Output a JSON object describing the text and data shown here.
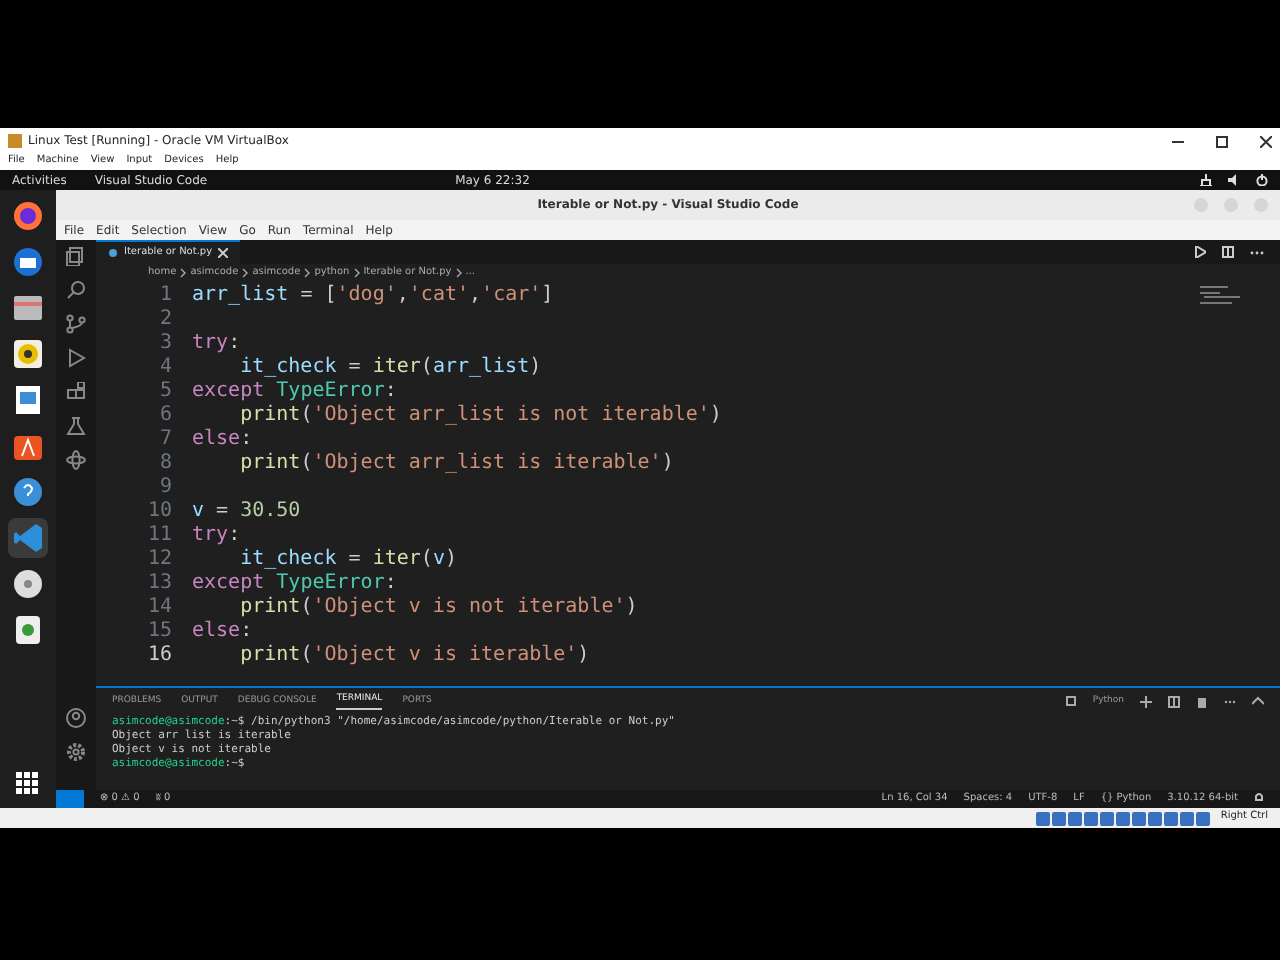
{
  "vbox": {
    "title": "Linux Test [Running] - Oracle VM VirtualBox",
    "menu": [
      "File",
      "Machine",
      "View",
      "Input",
      "Devices",
      "Help"
    ],
    "status_right": "Right Ctrl"
  },
  "topbar": {
    "activities": "Activities",
    "app": "Visual Studio Code",
    "clock": "May 6  22:32"
  },
  "dock": [
    {
      "kind": "firefox",
      "selected": false
    },
    {
      "kind": "thunderbird",
      "selected": false
    },
    {
      "kind": "files",
      "selected": false
    },
    {
      "kind": "rhythmbox",
      "selected": false
    },
    {
      "kind": "writer",
      "selected": false
    },
    {
      "kind": "software",
      "selected": false
    },
    {
      "kind": "help",
      "selected": false
    },
    {
      "kind": "vscode",
      "selected": true
    },
    {
      "kind": "disc",
      "selected": false
    },
    {
      "kind": "trash",
      "selected": false
    }
  ],
  "vscode": {
    "title": "Iterable or Not.py - Visual Studio Code",
    "menu": [
      "File",
      "Edit",
      "Selection",
      "View",
      "Go",
      "Run",
      "Terminal",
      "Help"
    ],
    "tab": "Iterable or Not.py",
    "breadcrumb": [
      "home",
      "asimcode",
      "asimcode",
      "python",
      "Iterable or Not.py",
      "..."
    ],
    "lines": [
      {
        "number": "1",
        "current": false,
        "tokens": [
          {
            "kind": "var",
            "text": "arr_list"
          },
          {
            "kind": "op",
            "text": " = ["
          },
          {
            "kind": "str",
            "text": "'dog'"
          },
          {
            "kind": "op",
            "text": ","
          },
          {
            "kind": "str",
            "text": "'cat'"
          },
          {
            "kind": "op",
            "text": ","
          },
          {
            "kind": "str",
            "text": "'car'"
          },
          {
            "kind": "op",
            "text": "]"
          }
        ]
      },
      {
        "number": "2",
        "current": false
      },
      {
        "number": "3",
        "current": false,
        "tokens": [
          {
            "kind": "kw",
            "text": "try"
          },
          {
            "kind": "op",
            "text": ":"
          }
        ]
      },
      {
        "number": "4",
        "current": false,
        "tokens": [
          {
            "kind": "var",
            "text": "    it_check"
          },
          {
            "kind": "op",
            "text": " = "
          },
          {
            "kind": "fn",
            "text": "iter"
          },
          {
            "kind": "op",
            "text": "("
          },
          {
            "kind": "var",
            "text": "arr_list"
          },
          {
            "kind": "op",
            "text": ")"
          }
        ]
      },
      {
        "number": "5",
        "current": false,
        "tokens": [
          {
            "kind": "kw",
            "text": "except "
          },
          {
            "kind": "cls",
            "text": "TypeError"
          },
          {
            "kind": "op",
            "text": ":"
          }
        ]
      },
      {
        "number": "6",
        "current": false,
        "tokens": [
          {
            "kind": "fn",
            "text": "    print"
          },
          {
            "kind": "op",
            "text": "("
          },
          {
            "kind": "str",
            "text": "'Object arr_list is not iterable'"
          },
          {
            "kind": "op",
            "text": ")"
          }
        ]
      },
      {
        "number": "7",
        "current": false,
        "tokens": [
          {
            "kind": "kw",
            "text": "else"
          },
          {
            "kind": "op",
            "text": ":"
          }
        ]
      },
      {
        "number": "8",
        "current": false,
        "tokens": [
          {
            "kind": "fn",
            "text": "    print"
          },
          {
            "kind": "op",
            "text": "("
          },
          {
            "kind": "str",
            "text": "'Object arr_list is iterable'"
          },
          {
            "kind": "op",
            "text": ")"
          }
        ]
      },
      {
        "number": "9",
        "current": false
      },
      {
        "number": "10",
        "current": false,
        "tokens": [
          {
            "kind": "var",
            "text": "v"
          },
          {
            "kind": "op",
            "text": " = "
          },
          {
            "kind": "num",
            "text": "30.50"
          }
        ]
      },
      {
        "number": "11",
        "current": false,
        "tokens": [
          {
            "kind": "kw",
            "text": "try"
          },
          {
            "kind": "op",
            "text": ":"
          }
        ]
      },
      {
        "number": "12",
        "current": false,
        "tokens": [
          {
            "kind": "var",
            "text": "    it_check"
          },
          {
            "kind": "op",
            "text": " = "
          },
          {
            "kind": "fn",
            "text": "iter"
          },
          {
            "kind": "op",
            "text": "("
          },
          {
            "kind": "var",
            "text": "v"
          },
          {
            "kind": "op",
            "text": ")"
          }
        ]
      },
      {
        "number": "13",
        "current": false,
        "tokens": [
          {
            "kind": "kw",
            "text": "except "
          },
          {
            "kind": "cls",
            "text": "TypeError"
          },
          {
            "kind": "op",
            "text": ":"
          }
        ]
      },
      {
        "number": "14",
        "current": false,
        "tokens": [
          {
            "kind": "fn",
            "text": "    print"
          },
          {
            "kind": "op",
            "text": "("
          },
          {
            "kind": "str",
            "text": "'Object v is not iterable'"
          },
          {
            "kind": "op",
            "text": ")"
          }
        ]
      },
      {
        "number": "15",
        "current": false,
        "tokens": [
          {
            "kind": "kw",
            "text": "else"
          },
          {
            "kind": "op",
            "text": ":"
          }
        ]
      },
      {
        "number": "16",
        "current": true,
        "tokens": [
          {
            "kind": "fn",
            "text": "    print"
          },
          {
            "kind": "op",
            "text": "("
          },
          {
            "kind": "str",
            "text": "'Object v is iterable'"
          },
          {
            "kind": "op",
            "text": ")"
          }
        ]
      }
    ],
    "panel_tabs": [
      {
        "label": "PROBLEMS",
        "selected": false
      },
      {
        "label": "OUTPUT",
        "selected": false
      },
      {
        "label": "DEBUG CONSOLE",
        "selected": false
      },
      {
        "label": "TERMINAL",
        "selected": true
      },
      {
        "label": "PORTS",
        "selected": false
      }
    ],
    "terminal_profile": "Python",
    "terminal": [
      {
        "kind": "prompt",
        "prompt": "asimcode@asimcode",
        "rest": ":~$ /bin/python3 \"/home/asimcode/asimcode/python/Iterable or Not.py\""
      },
      {
        "kind": "output",
        "text": "Object arr list is iterable"
      },
      {
        "kind": "output",
        "text": "Object v is not iterable"
      },
      {
        "kind": "prompt",
        "prompt": "asimcode@asimcode",
        "rest": ":~$ "
      }
    ],
    "status_left": [
      "⊗ 0 ⚠ 0",
      "ʬ 0"
    ],
    "status_right": [
      "Ln 16, Col 34",
      "Spaces: 4",
      "UTF-8",
      "LF",
      "{} Python",
      "3.10.12 64-bit"
    ]
  }
}
